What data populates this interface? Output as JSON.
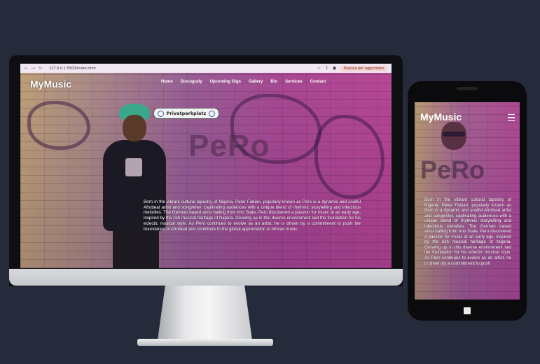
{
  "browser": {
    "url": "127.0.0.1:5500/index.html",
    "update_button": "Riavvia per aggiornare"
  },
  "site": {
    "logo": "MyMusic",
    "nav": [
      "Home",
      "Discografy",
      "Upcoming Gigs",
      "Gallery",
      "Bio",
      "Services",
      "Contact"
    ],
    "sign_text": "Privatparkplatz",
    "hero_title": "PeRo",
    "about": "Born in the vibrant cultural tapestry of Nigeria, Peter Fabian, popularly known as Pero is a dynamic and soulful Afrobeat artist and songwriter, captivating audiences with a unique blend of rhythmic storytelling and infectious melodies. The German based artist hailing from Imo State, Pero discovered a passion for music at an early age, inspired by the rich musical heritage of Nigeria. Growing up in this diverse environment laid the foundation for his eclectic musical style. As Pero continues to evolve as an artist, he is driven by a commitment to push the boundaries of Afrobeat and contribute to the global appreciation of African music."
  },
  "mobile": {
    "logo": "MyMusic",
    "hero_title": "PeRo",
    "about": "Born in the vibrant cultural tapestry of Nigeria, Peter Fabian, popularly known as Pero is a dynamic and soulful Afrobeat artist and songwriter, captivating audiences with a unique blend of rhythmic storytelling and infectious melodies. The German based artist hailing from Imo State, Pero discovered a passion for music at an early age, inspired by the rich musical heritage of Nigeria. Growing up in this diverse environment laid the foundation for his eclectic musical style. As Pero continues to evolve as an artist, he is driven by a commitment to push"
  }
}
